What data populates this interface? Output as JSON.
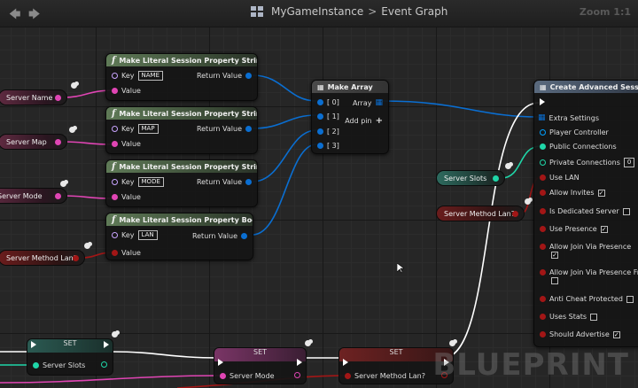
{
  "toolbar": {
    "title": "MyGameInstance",
    "separator": ">",
    "graph": "Event Graph",
    "zoom": "Zoom 1:1",
    "back_icon": "back-arrow-icon",
    "forward_icon": "forward-arrow-icon"
  },
  "literal_nodes": [
    {
      "title": "Make Literal Session Property String",
      "key_label": "Key",
      "key_value": "NAME",
      "value_label": "Value",
      "return_label": "Return Value"
    },
    {
      "title": "Make Literal Session Property String",
      "key_label": "Key",
      "key_value": "MAP",
      "value_label": "Value",
      "return_label": "Return Value"
    },
    {
      "title": "Make Literal Session Property String",
      "key_label": "Key",
      "key_value": "MODE",
      "value_label": "Value",
      "return_label": "Return Value"
    },
    {
      "title": "Make Literal Session Property Bool",
      "key_label": "Key",
      "key_value": "LAN",
      "value_label": "Value",
      "return_label": "Return Value"
    }
  ],
  "make_array": {
    "title": "Make Array",
    "inputs": [
      "[ 0]",
      "[ 1]",
      "[ 2]",
      "[ 3]"
    ],
    "output_label": "Array",
    "add_pin_label": "Add pin"
  },
  "variables": {
    "server_name": "Server Name",
    "server_map": "Server Map",
    "server_mode": "Server Mode",
    "server_method_lan": "Server Method Lan?",
    "server_slots": "Server Slots",
    "server_method_lan_right": "Server Method Lan?"
  },
  "create_session": {
    "title": "Create Advanced Session",
    "extra_settings": "Extra Settings",
    "player_controller": "Player Controller",
    "public_connections": "Public Connections",
    "private_connections": "Private Connections",
    "private_connections_value": "0",
    "use_lan": "Use LAN",
    "allow_invites": "Allow Invites",
    "is_dedicated_server": "Is Dedicated Server",
    "use_presence": "Use Presence",
    "allow_join_via_presence": "Allow Join Via Presence",
    "allow_join_via_presence_friends": "Allow Join Via Presence Frie",
    "anti_cheat_protected": "Anti Cheat Protected",
    "uses_stats": "Uses Stats",
    "should_advertise": "Should Advertise",
    "checked": "✓"
  },
  "set_nodes": [
    {
      "title": "SET",
      "var": "Server Slots"
    },
    {
      "title": "SET",
      "var": "Server Mode"
    },
    {
      "title": "SET",
      "var": "Server Method Lan?"
    }
  ],
  "watermark": "BLUEPRINT",
  "colors": {
    "string_pin": "#e045b4",
    "struct_pin": "#0a6ed1",
    "bool_pin": "#a21616",
    "int_pin": "#1fd6a8",
    "object_pin": "#00a0ff"
  }
}
